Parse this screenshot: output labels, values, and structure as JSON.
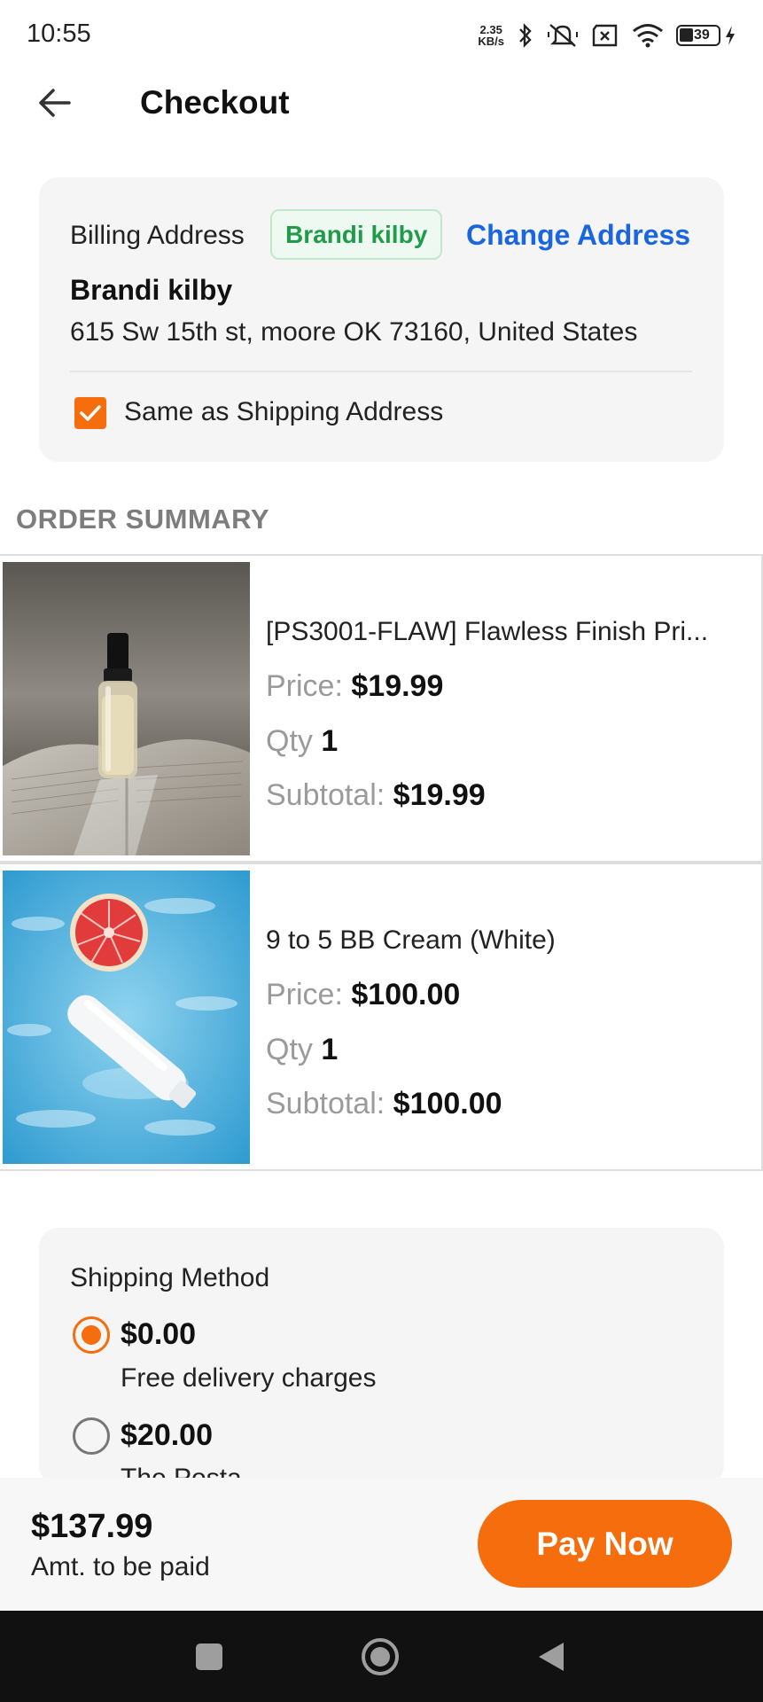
{
  "status_bar": {
    "time": "10:55",
    "net_speed_value": "2.35",
    "net_speed_unit": "KB/s",
    "battery": "39",
    "icons": [
      "bluetooth-icon",
      "mute-icon",
      "sim-icon",
      "wifi-icon",
      "battery-icon",
      "charging-icon"
    ]
  },
  "header": {
    "title": "Checkout",
    "back_icon": "arrow-left-icon"
  },
  "billing": {
    "label": "Billing Address",
    "badge": "Brandi kilby",
    "change_label": "Change Address",
    "name": "Brandi kilby",
    "address": "615 Sw 15th st, moore OK 73160, United States",
    "same_as_shipping_label": "Same as Shipping Address",
    "same_as_shipping_checked": true
  },
  "order_summary": {
    "title": "ORDER SUMMARY",
    "price_label": "Price:",
    "qty_label": "Qty",
    "subtotal_label": "Subtotal:",
    "items": [
      {
        "name": "[PS3001-FLAW] Flawless Finish Pri...",
        "price": "$19.99",
        "qty": "1",
        "subtotal": "$19.99",
        "image": "serum-bottle-on-book"
      },
      {
        "name": "9 to 5 BB Cream (White)",
        "price": "$100.00",
        "qty": "1",
        "subtotal": "$100.00",
        "image": "cream-tube-in-water-with-grapefruit"
      }
    ]
  },
  "shipping": {
    "title": "Shipping Method",
    "options": [
      {
        "price": "$0.00",
        "description": "Free delivery charges",
        "selected": true
      },
      {
        "price": "$20.00",
        "description": "The Posta",
        "selected": false
      }
    ]
  },
  "footer": {
    "total": "$137.99",
    "total_label": "Amt. to be paid",
    "pay_button": "Pay Now"
  },
  "colors": {
    "accent": "#f56d0c",
    "link": "#1a66e0",
    "badge_text": "#1f9b4a",
    "badge_bg": "#eefaf1"
  }
}
